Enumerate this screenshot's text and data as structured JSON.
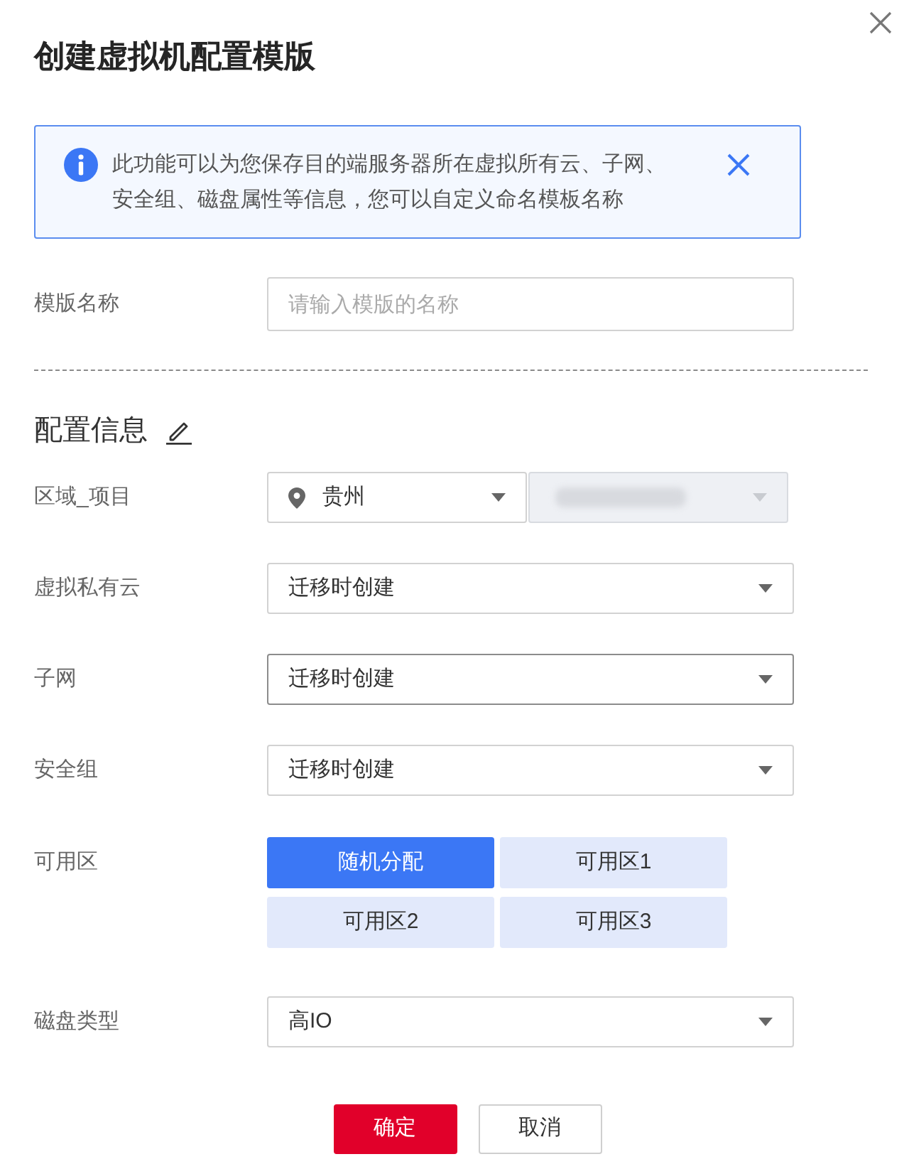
{
  "dialog": {
    "title": "创建虚拟机配置模版"
  },
  "alert": {
    "message": "此功能可以为您保存目的端服务器所在虚拟所有云、子网、安全组、磁盘属性等信息，您可以自定义命名模板名称"
  },
  "name_field": {
    "label": "模版名称",
    "placeholder": "请输入模版的名称"
  },
  "config": {
    "title": "配置信息",
    "rows": [
      {
        "kind": "region",
        "label": "区域_项目",
        "selects": [
          {
            "value": "贵州",
            "disabled": false,
            "redacted": false
          },
          {
            "disabled": true,
            "redacted": true
          }
        ]
      },
      {
        "kind": "select",
        "label": "虚拟私有云",
        "value": "迁移时创建",
        "focused": false
      },
      {
        "kind": "select",
        "label": "子网",
        "value": "迁移时创建",
        "focused": true
      },
      {
        "kind": "select",
        "label": "安全组",
        "value": "迁移时创建",
        "focused": false
      },
      {
        "kind": "choices",
        "label": "可用区",
        "options": [
          {
            "label": "随机分配",
            "selected": true
          },
          {
            "label": "可用区1",
            "selected": false
          },
          {
            "label": "可用区2",
            "selected": false
          },
          {
            "label": "可用区3",
            "selected": false
          }
        ]
      },
      {
        "kind": "select",
        "label": "磁盘类型",
        "value": "高IO",
        "focused": false
      }
    ]
  },
  "buttons": [
    {
      "label": "确定",
      "kind": "primary"
    },
    {
      "label": "取消",
      "kind": "secondary"
    }
  ]
}
